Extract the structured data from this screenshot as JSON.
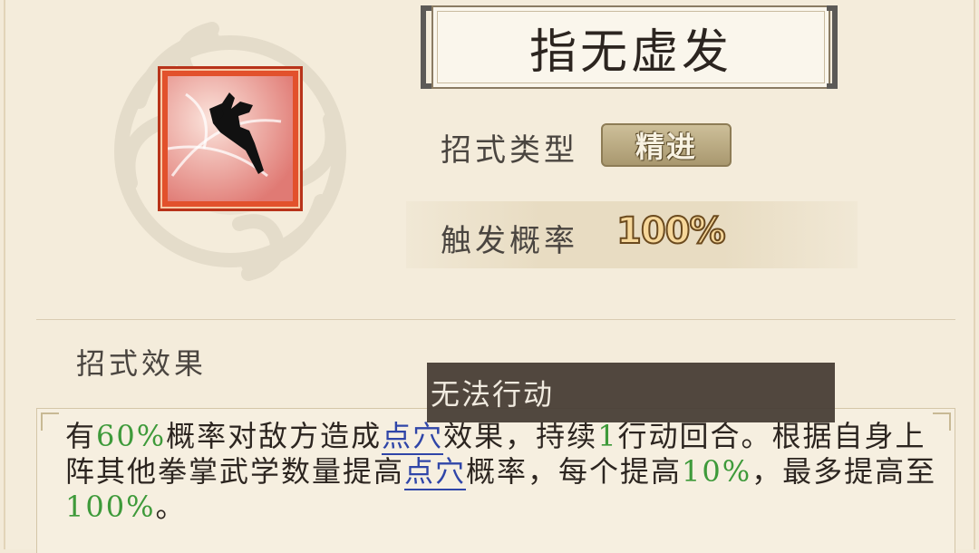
{
  "skill": {
    "name": "指无虚发",
    "icon": "hand-strike-icon"
  },
  "rows": {
    "type_label": "招式类型",
    "type_value": "精进",
    "rate_label": "触发概率",
    "rate_value": "100%"
  },
  "effect": {
    "title": "招式效果",
    "parts": {
      "p1": "有",
      "p1_pct": "60%",
      "p2": "概率对敌方造成",
      "link1": "点穴",
      "p3": "效果，持续",
      "p3_num": "1",
      "p4": "行动回合。根据自身上阵其他拳掌武学数量提高",
      "link2": "点穴",
      "p5": "概率，每个提高",
      "p5_pct": "10%",
      "p6": "，最多提高至",
      "p6_pct": "100%",
      "p7": "。"
    }
  },
  "tooltip": {
    "text": "无法行动"
  },
  "colors": {
    "highlight_green": "#3e9a3a",
    "link_blue": "#2f45a8",
    "icon_frame_red": "#e2512c"
  }
}
